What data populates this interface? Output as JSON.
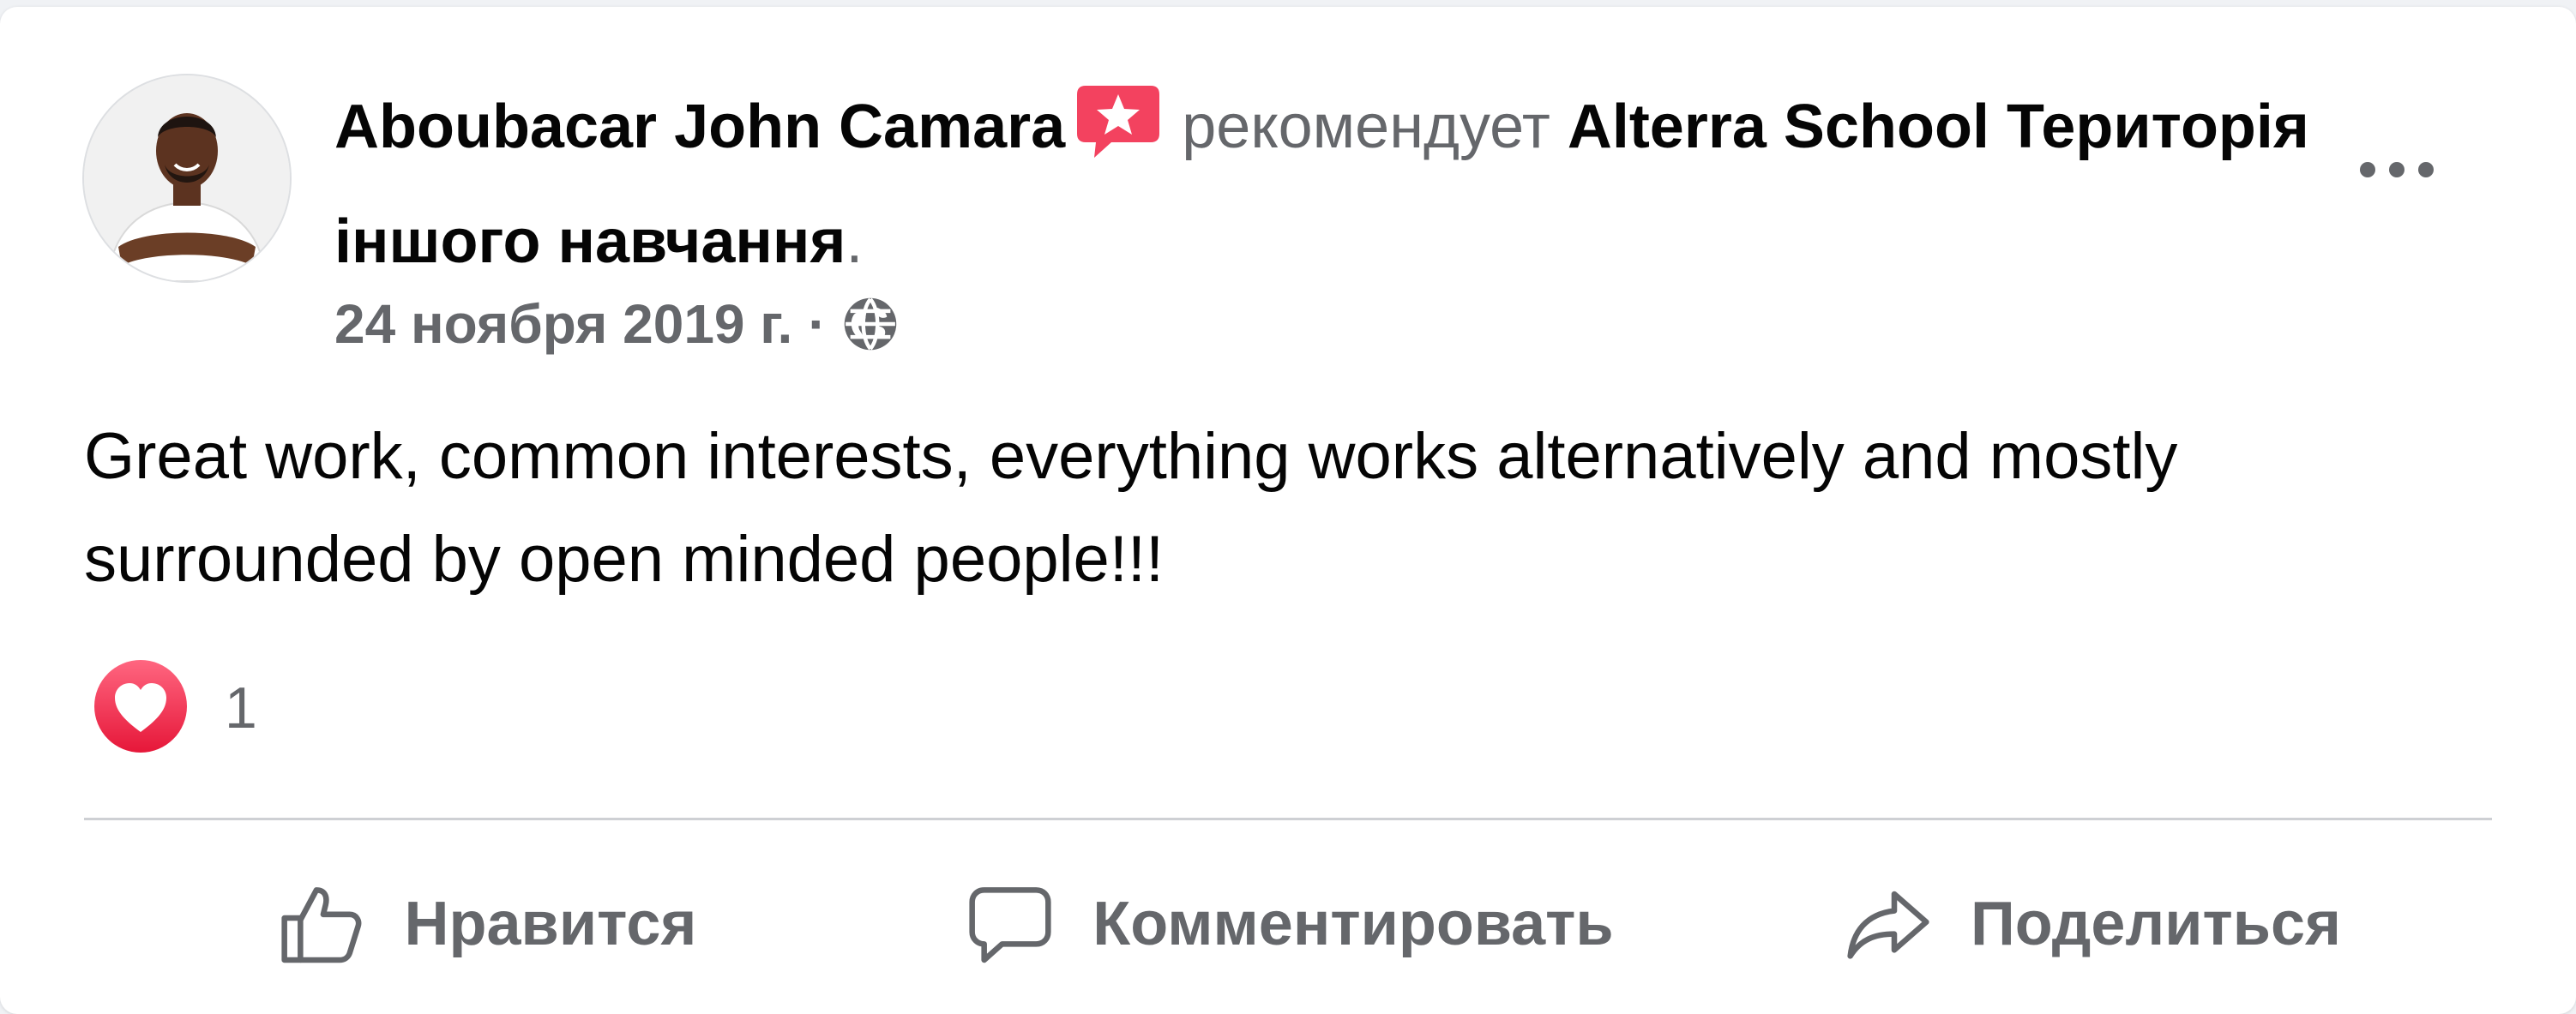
{
  "post": {
    "author": "Aboubacar John Camara",
    "verb": "рекомендует",
    "page_name": "Alterra School Територія іншого навчання",
    "end_punct": ".",
    "date": "24 ноября 2019 г.",
    "separator": "·",
    "privacy_icon": "globe-icon",
    "badge_icon": "recommend-star-icon",
    "more_icon": "more-options-icon",
    "text": "Great work, common interests, everything works alternatively and mostly surrounded by open minded people!!!"
  },
  "reactions": {
    "icon": "love-heart-icon",
    "count": "1"
  },
  "actions": {
    "like": {
      "label": "Нравится",
      "icon": "thumbs-up-icon"
    },
    "comment": {
      "label": "Комментировать",
      "icon": "comment-bubble-icon"
    },
    "share": {
      "label": "Поделиться",
      "icon": "share-arrow-icon"
    }
  },
  "colors": {
    "text_primary": "#050505",
    "text_secondary": "#65676b",
    "badge": "#f3425f",
    "love": "#f33e58",
    "divider": "#ced0d4"
  }
}
